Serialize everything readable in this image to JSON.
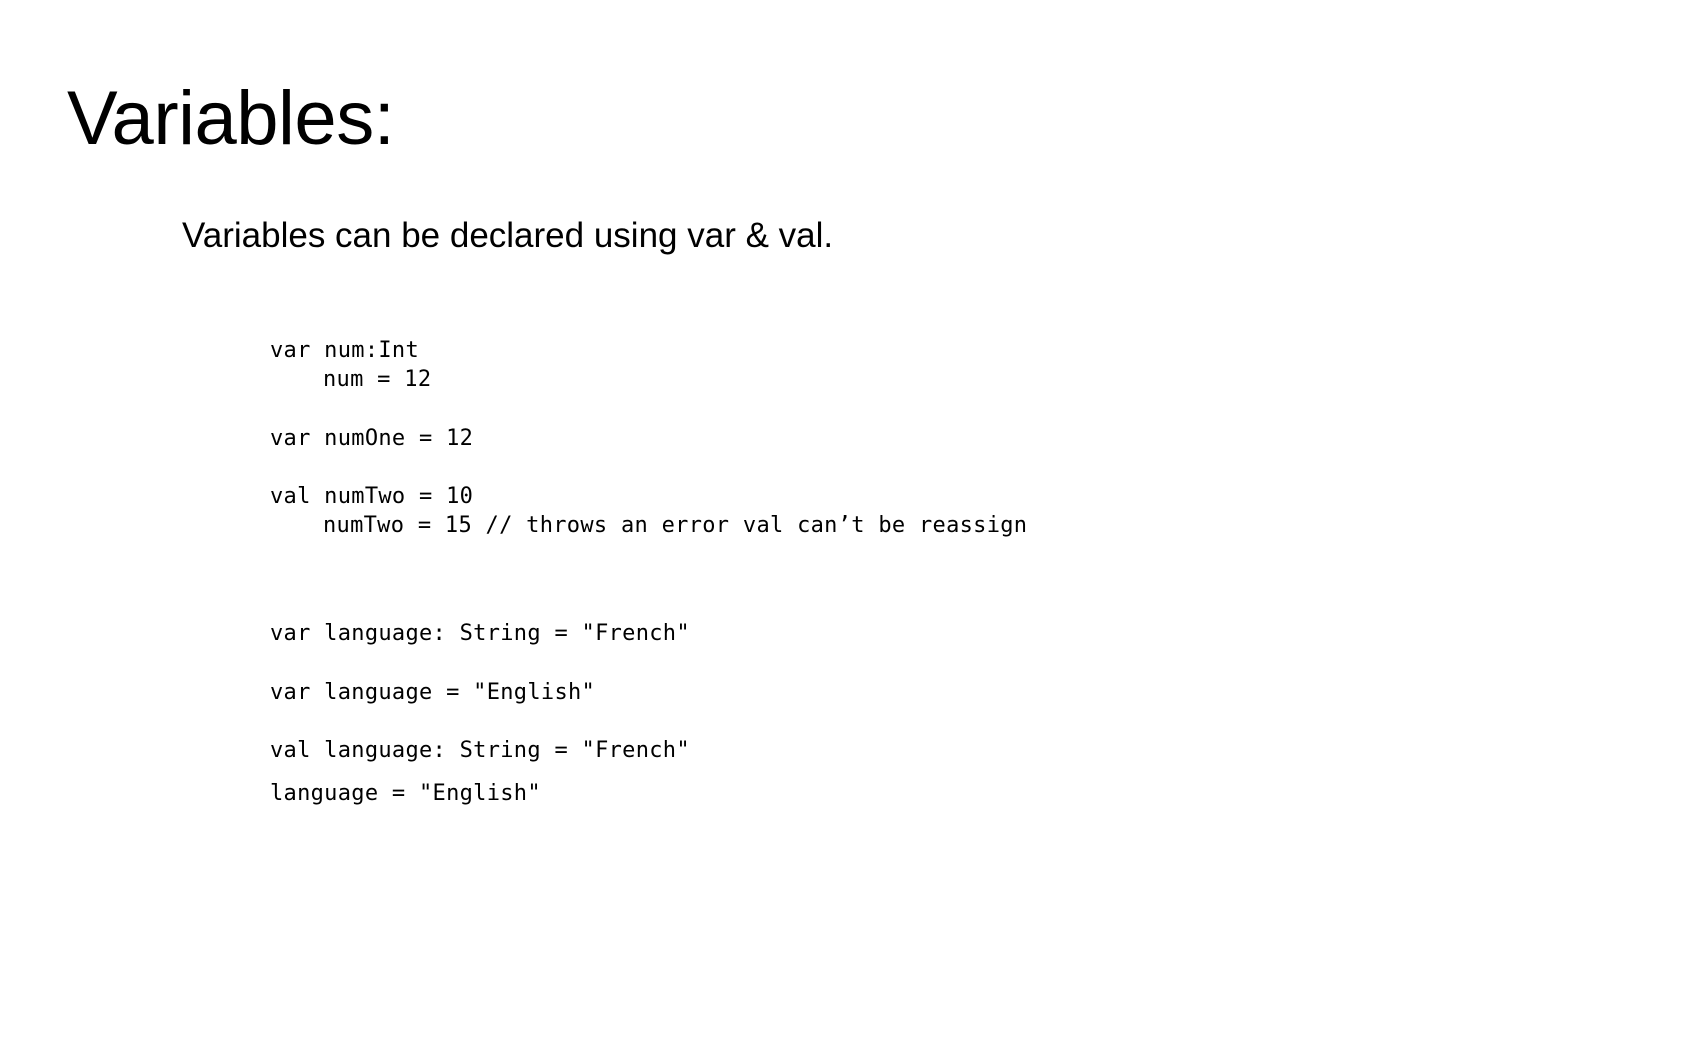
{
  "slide": {
    "title": "Variables:",
    "subtitle": "Variables can be declared using var & val."
  },
  "code": {
    "lines": [
      "var num:Int",
      "num = 12",
      "var numOne = 12",
      "val numTwo = 10",
      "numTwo = 15 // throws an error val can’t be reassign",
      "var language: String = \"French\"",
      "var language = \"English\"",
      "val language: String = \"French\"",
      "language = \"English\""
    ]
  }
}
